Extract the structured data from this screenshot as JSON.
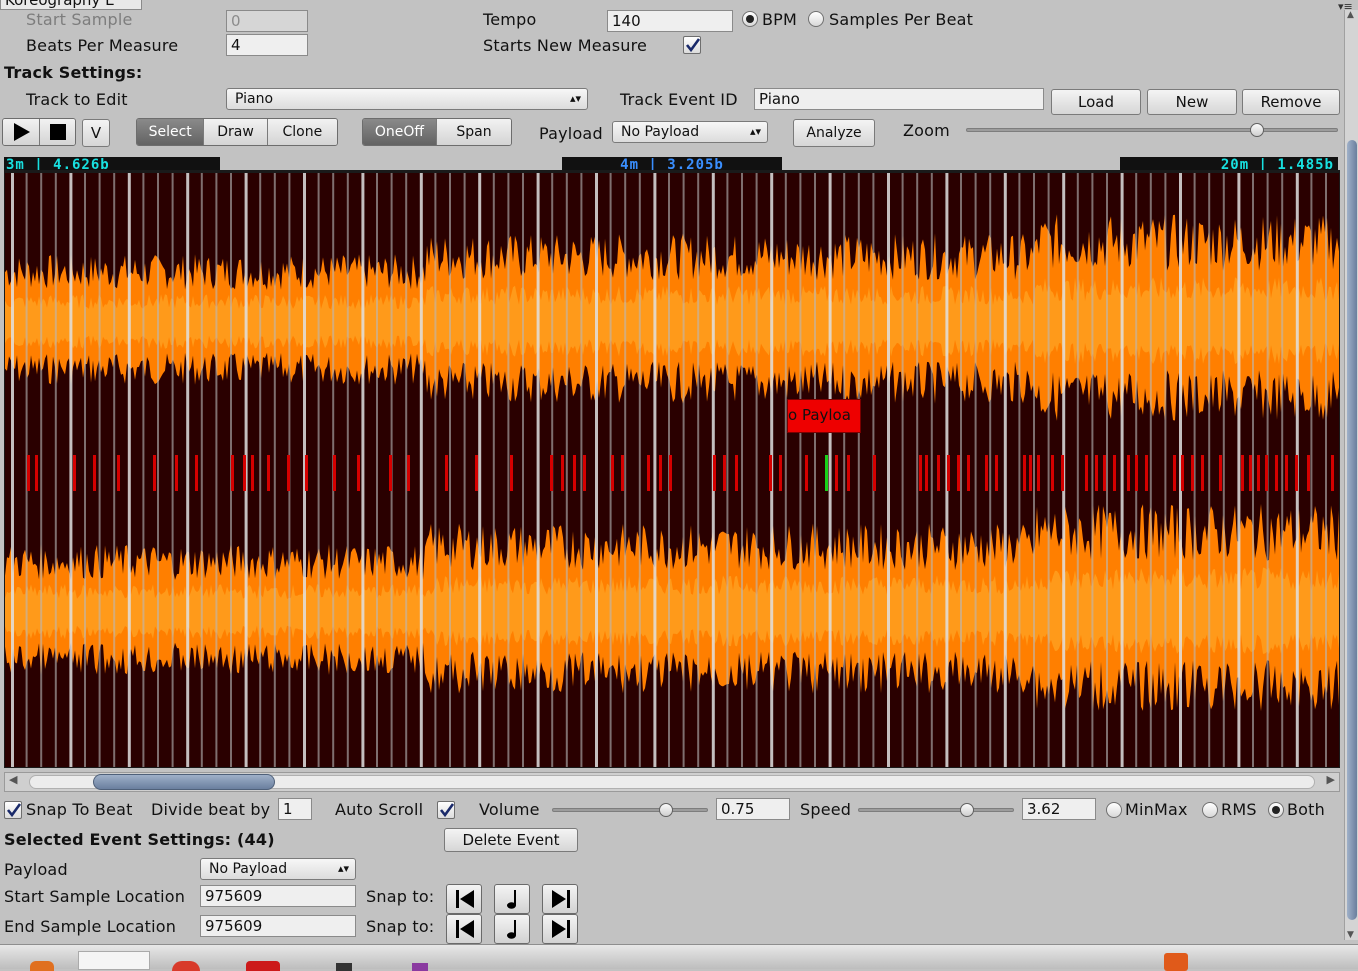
{
  "window": {
    "title": "Koreography E"
  },
  "top_settings": {
    "start_sample_label": "Start Sample",
    "start_sample_value": "0",
    "beats_per_measure_label": "Beats Per Measure",
    "beats_per_measure_value": "4",
    "tempo_label": "Tempo",
    "tempo_value": "140",
    "tempo_mode_options": [
      "BPM",
      "Samples Per Beat"
    ],
    "tempo_mode_selected": "BPM",
    "starts_new_measure_label": "Starts New Measure",
    "starts_new_measure_checked": true
  },
  "track_settings": {
    "heading": "Track Settings:",
    "track_to_edit_label": "Track to Edit",
    "track_to_edit_value": "Piano",
    "track_event_id_label": "Track Event ID",
    "track_event_id_value": "Piano",
    "load_label": "Load",
    "new_label": "New",
    "remove_label": "Remove"
  },
  "toolbar": {
    "play_icon": "play-icon",
    "stop_icon": "stop-icon",
    "v_label": "V",
    "edit_modes": [
      "Select",
      "Draw",
      "Clone"
    ],
    "edit_mode_selected": "Select",
    "event_types": [
      "OneOff",
      "Span"
    ],
    "event_type_selected": "OneOff",
    "payload_label": "Payload",
    "payload_value": "No Payload",
    "analyze_label": "Analyze",
    "zoom_label": "Zoom",
    "zoom_level": 0.88
  },
  "timeline": {
    "left_marker": "3m  |  4.626b",
    "center_marker": "4m  |  3.205b",
    "right_marker": "20m  |  1.485b",
    "event_payload_label": "o Payloa",
    "colors": {
      "background": "#2a0000",
      "wave_outer": "#ff7f00",
      "wave_inner": "#ff9a1a",
      "beat_line": "#b9b9b9",
      "event_mark": "#d60000",
      "selected_event": "#19d119",
      "ruler_text": "#18e0e0"
    },
    "scroll_position": 0.07
  },
  "playback": {
    "snap_to_beat_label": "Snap To Beat",
    "snap_to_beat_checked": true,
    "divide_beat_label": "Divide beat by",
    "divide_beat_value": "1",
    "auto_scroll_label": "Auto Scroll",
    "auto_scroll_checked": true,
    "volume_label": "Volume",
    "volume_value": "0.75",
    "speed_label": "Speed",
    "speed_value": "3.62",
    "display_options": [
      "MinMax",
      "RMS",
      "Both"
    ],
    "display_selected": "Both"
  },
  "selected_event": {
    "heading": "Selected Event Settings: (44)",
    "delete_label": "Delete Event",
    "payload_label": "Payload",
    "payload_value": "No Payload",
    "start_label": "Start Sample Location",
    "start_value": "975609",
    "end_label": "End Sample Location",
    "end_value": "975609",
    "snap_to_label": "Snap to:"
  }
}
